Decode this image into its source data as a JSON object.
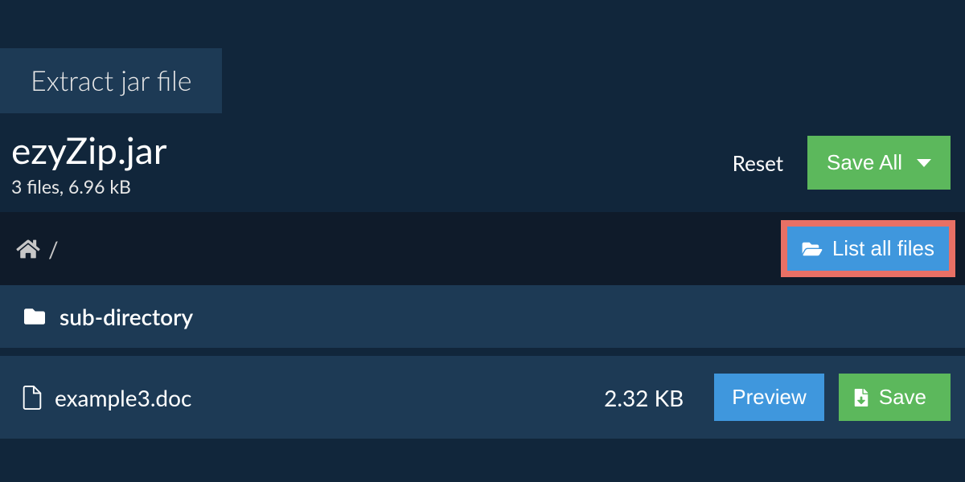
{
  "tab": {
    "label": "Extract jar file"
  },
  "header": {
    "filename": "ezyZip.jar",
    "meta": "3 files, 6.96 kB",
    "reset_label": "Reset",
    "save_all_label": "Save All"
  },
  "breadcrumb": {
    "path": "/",
    "list_all_label": "List all files"
  },
  "rows": [
    {
      "name": "sub-directory"
    },
    {
      "name": "example3.doc",
      "size": "2.32 KB",
      "preview_label": "Preview",
      "save_label": "Save"
    }
  ]
}
